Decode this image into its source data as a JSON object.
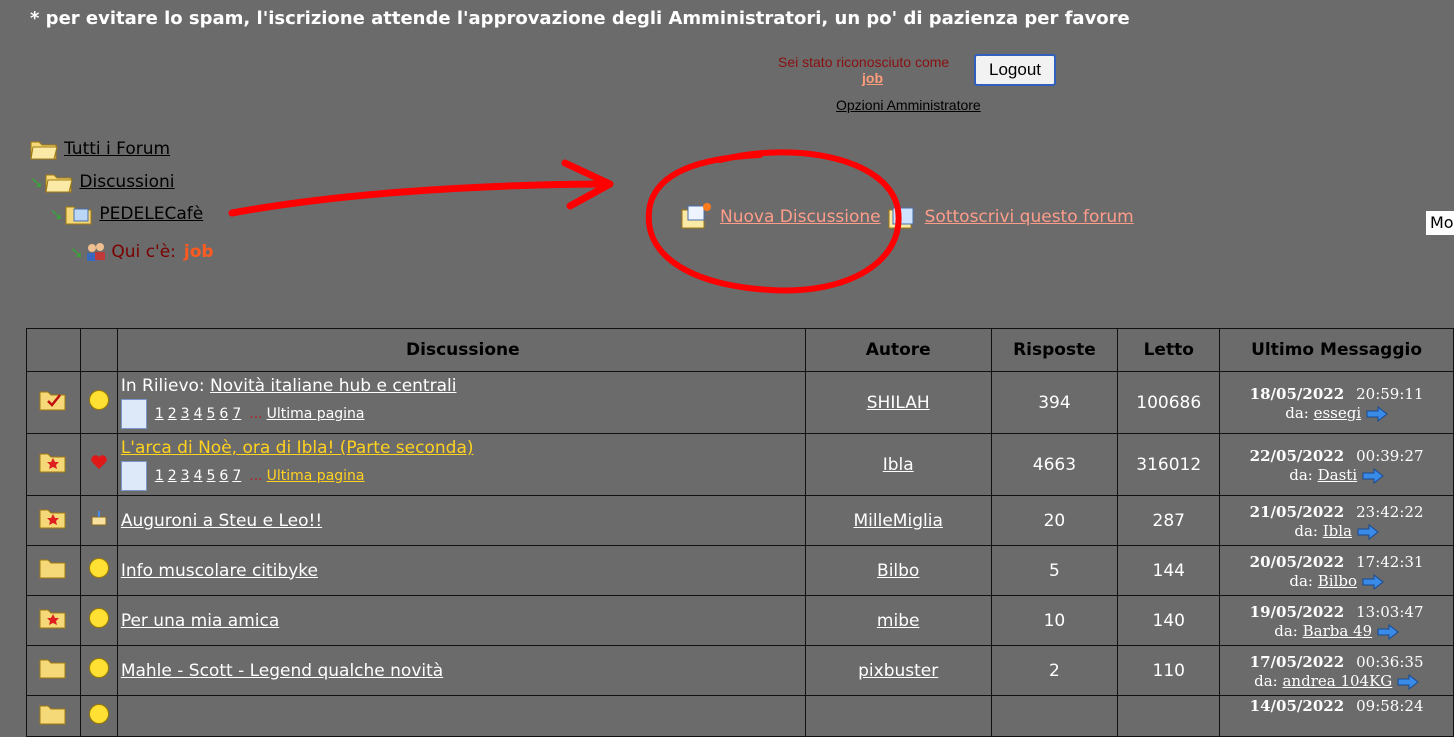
{
  "notice": "* per evitare lo spam, l'iscrizione attende l'approvazione degli Amministratori, un po' di pazienza per favore",
  "login": {
    "recognized_text": "Sei stato riconosciuto come",
    "username": "job",
    "logout_label": "Logout",
    "admin_options": "Opzioni Amministratore"
  },
  "breadcrumb": {
    "all_forums": "Tutti i Forum",
    "category": "Discussioni",
    "forum": "PEDELECafè",
    "here_label": "Qui c'è:",
    "here_user": "job"
  },
  "actions": {
    "new_topic": "Nuova Discussione",
    "subscribe": "Sottoscrivi questo forum",
    "side_box": "Mo"
  },
  "table": {
    "headers": {
      "topic": "Discussione",
      "author": "Autore",
      "replies": "Risposte",
      "read": "Letto",
      "last": "Ultimo Messaggio"
    },
    "pages_last_label": "Ultima pagina",
    "pages_dots": "...",
    "by_label": "da:",
    "rows": [
      {
        "prefix": "In Rilievo:",
        "title": "Novità italiane hub e centrali",
        "pages": [
          "1",
          "2",
          "3",
          "4",
          "5",
          "6",
          "7"
        ],
        "author": "SHILAH",
        "replies": "394",
        "read": "100686",
        "date": "18/05/2022",
        "time": "20:59:11",
        "by": "essegi"
      },
      {
        "prefix": "",
        "title": "L'arca di Noè, ora di Ibla! (Parte seconda)",
        "pages": [
          "1",
          "2",
          "3",
          "4",
          "5",
          "6",
          "7"
        ],
        "author": "Ibla",
        "replies": "4663",
        "read": "316012",
        "date": "22/05/2022",
        "time": "00:39:27",
        "by": "Dasti"
      },
      {
        "prefix": "",
        "title": "Auguroni a Steu e Leo!!",
        "author": "MilleMiglia",
        "replies": "20",
        "read": "287",
        "date": "21/05/2022",
        "time": "23:42:22",
        "by": "Ibla"
      },
      {
        "prefix": "",
        "title": "Info muscolare citibyke",
        "author": "Bilbo",
        "replies": "5",
        "read": "144",
        "date": "20/05/2022",
        "time": "17:42:31",
        "by": "Bilbo"
      },
      {
        "prefix": "",
        "title": "Per una mia amica",
        "author": "mibe",
        "replies": "10",
        "read": "140",
        "date": "19/05/2022",
        "time": "13:03:47",
        "by": "Barba 49"
      },
      {
        "prefix": "",
        "title": "Mahle - Scott - Legend qualche novità",
        "author": "pixbuster",
        "replies": "2",
        "read": "110",
        "date": "17/05/2022",
        "time": "00:36:35",
        "by": "andrea 104KG"
      },
      {
        "prefix": "",
        "title": "",
        "author": "",
        "replies": "",
        "read": "",
        "date": "14/05/2022",
        "time": "09:58:24",
        "by": ""
      }
    ]
  },
  "colors": {
    "background": "#6b6b6b",
    "link_highlight": "#ffd21f",
    "link_salmon": "#ff9c8a",
    "annotation_red": "#ff0000"
  }
}
